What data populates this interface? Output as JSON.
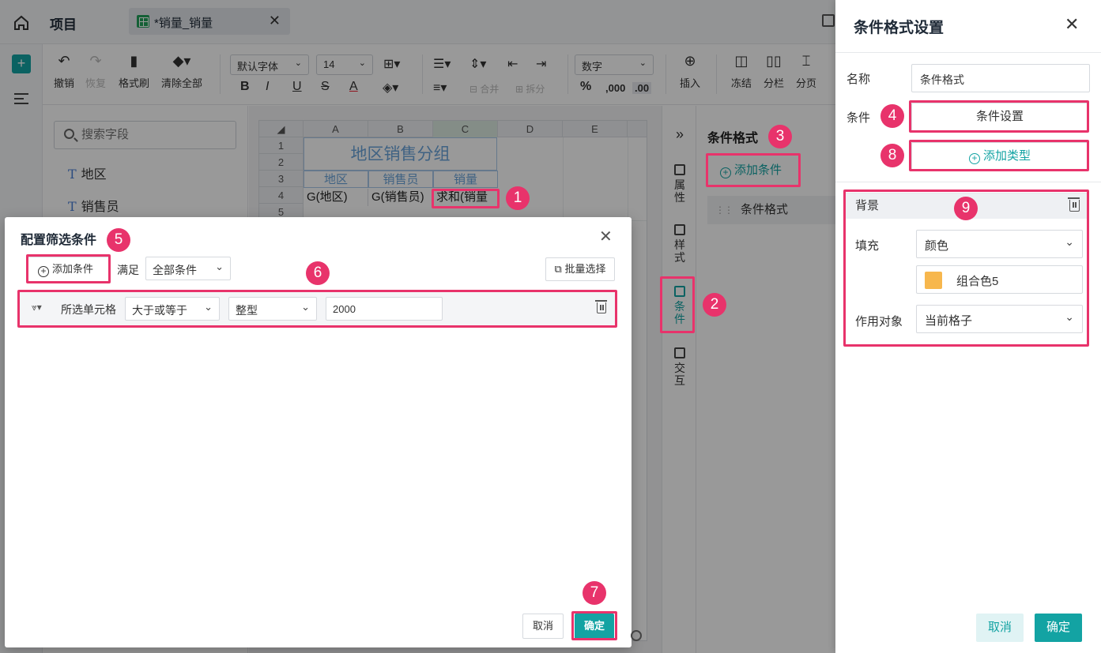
{
  "topbar": {
    "project_label": "项目",
    "tab_title": "*销量_销量",
    "tab_close": "✕"
  },
  "toolbar": {
    "undo": "撤销",
    "redo": "恢复",
    "format_painter": "格式刷",
    "clear_all": "清除全部",
    "font_family": "默认字体",
    "font_size": "14",
    "number_format": "数字",
    "merge": "合并",
    "split": "拆分",
    "insert": "插入",
    "freeze": "冻结",
    "columns": "分栏",
    "page": "分页",
    "bold": "B",
    "italic": "I",
    "underline": "U",
    "strike": "S",
    "font_color": "A",
    "percent": "%",
    "thousands": ",000",
    "decimals": ".00"
  },
  "fields": {
    "search_placeholder": "搜索字段",
    "items": [
      "地区",
      "销售员"
    ]
  },
  "sheet": {
    "columns": [
      "A",
      "B",
      "C",
      "D",
      "E"
    ],
    "rows": [
      "1",
      "2",
      "3",
      "4",
      "5"
    ],
    "title": "地区销售分组",
    "headers": [
      "地区",
      "销售员",
      "销量"
    ],
    "cells": [
      "G(地区)",
      "G(销售员)",
      "求和(销量"
    ]
  },
  "sidecol": {
    "expand": "»",
    "items": [
      "属性",
      "样式",
      "条件",
      "交互"
    ],
    "active": "条件"
  },
  "condpanel": {
    "title": "条件格式",
    "add_label": "添加条件",
    "item_label": "条件格式",
    "drag": "⋮⋮"
  },
  "drawer": {
    "title": "条件格式设置",
    "name_label": "名称",
    "name_value": "条件格式",
    "condition_label": "条件",
    "condition_button": "条件设置",
    "add_type_button": "添加类型",
    "bg_title": "背景",
    "fill_label": "填充",
    "fill_value": "颜色",
    "color_value": "组合色5",
    "target_label": "作用对象",
    "target_value": "当前格子",
    "cancel": "取消",
    "ok": "确定",
    "swatch_color": "#f7b74d"
  },
  "dialog": {
    "title": "配置筛选条件",
    "add_condition": "添加条件",
    "meet_label": "满足",
    "meet_value": "全部条件",
    "batch_select": "批量选择",
    "row": {
      "cell_label": "所选单元格",
      "operator": "大于或等于",
      "type": "整型",
      "value": "2000"
    },
    "cancel": "取消",
    "ok": "确定"
  },
  "badges": [
    "1",
    "2",
    "3",
    "4",
    "5",
    "6",
    "7",
    "8",
    "9"
  ],
  "colors": {
    "accent": "#13a3a3",
    "annotation": "#e8336b"
  }
}
